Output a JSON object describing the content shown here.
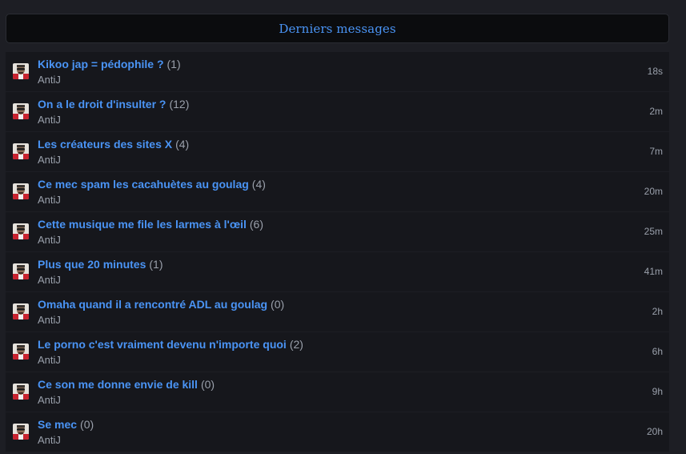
{
  "header": {
    "title": "Derniers messages"
  },
  "topics": [
    {
      "title": "Kikoo jap = pédophile ?",
      "count": "(1)",
      "author": "AntiJ",
      "time": "18s"
    },
    {
      "title": "On a le droit d'insulter ?",
      "count": "(12)",
      "author": "AntiJ",
      "time": "2m"
    },
    {
      "title": "Les créateurs des sites X",
      "count": "(4)",
      "author": "AntiJ",
      "time": "7m"
    },
    {
      "title": "Ce mec spam les cacahuètes au goulag",
      "count": "(4)",
      "author": "AntiJ",
      "time": "20m"
    },
    {
      "title": "Cette musique me file les larmes à l'œil",
      "count": "(6)",
      "author": "AntiJ",
      "time": "25m"
    },
    {
      "title": "Plus que 20 minutes",
      "count": "(1)",
      "author": "AntiJ",
      "time": "41m"
    },
    {
      "title": "Omaha quand il a rencontré ADL au goulag",
      "count": "(0)",
      "author": "AntiJ",
      "time": "2h"
    },
    {
      "title": "Le porno c'est vraiment devenu n'importe quoi",
      "count": "(2)",
      "author": "AntiJ",
      "time": "6h"
    },
    {
      "title": "Ce son me donne envie de kill",
      "count": "(0)",
      "author": "AntiJ",
      "time": "9h"
    },
    {
      "title": "Se mec",
      "count": "(0)",
      "author": "AntiJ",
      "time": "20h"
    }
  ],
  "colors": {
    "accent": "#4a94f5",
    "muted": "#9aa0ab",
    "row_bg": "#16171c",
    "page_bg": "#1d1e24",
    "header_bg": "#0b0c0e"
  },
  "icons": {
    "avatar": "user-avatar-icon"
  }
}
